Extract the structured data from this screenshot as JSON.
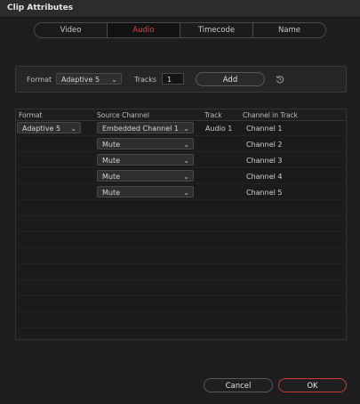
{
  "window": {
    "title": "Clip Attributes"
  },
  "tabs": [
    {
      "label": "Video"
    },
    {
      "label": "Audio",
      "active": true
    },
    {
      "label": "Timecode"
    },
    {
      "label": "Name"
    }
  ],
  "add_bar": {
    "format_label": "Format",
    "format_value": "Adaptive 5",
    "tracks_label": "Tracks",
    "tracks_value": "1",
    "add_label": "Add",
    "reset_icon": "reset-icon"
  },
  "table": {
    "headers": {
      "format": "Format",
      "source_channel": "Source Channel",
      "track": "Track",
      "channel_in_track": "Channel in Track"
    },
    "format_value": "Adaptive 5",
    "track_value": "Audio 1",
    "rows": [
      {
        "source": "Embedded Channel 1",
        "channel": "Channel 1"
      },
      {
        "source": "Mute",
        "channel": "Channel 2"
      },
      {
        "source": "Mute",
        "channel": "Channel 3"
      },
      {
        "source": "Mute",
        "channel": "Channel 4"
      },
      {
        "source": "Mute",
        "channel": "Channel 5"
      }
    ]
  },
  "footer": {
    "cancel_label": "Cancel",
    "ok_label": "OK"
  },
  "colors": {
    "accent": "#e0433a",
    "ok_border": "#c93a32",
    "background": "#1e1e20"
  }
}
